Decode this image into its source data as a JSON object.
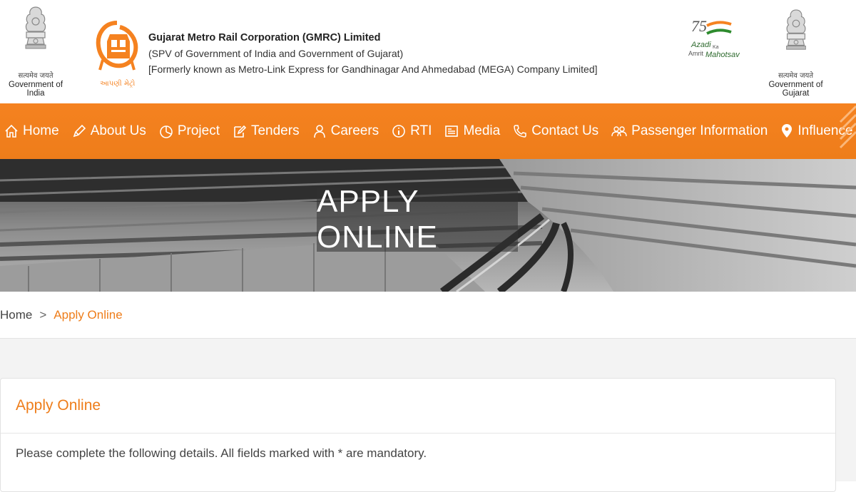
{
  "header": {
    "left_emblem": {
      "caption_hindi": "सत्यमेव जयते",
      "caption": "Government of India"
    },
    "company_name": "Gujarat Metro Rail Corporation (GMRC) Limited",
    "company_line1": "(SPV of Government of India and Government of Gujarat)",
    "company_line2": "[Formerly known as Metro-Link Express for Gandhinagar And Ahmedabad (MEGA) Company Limited]",
    "logo_tagline": "આપણી મેટ્રો",
    "azadi": {
      "number": "75",
      "word1": "Azadi",
      "word2": "Ka",
      "word3": "Amrit",
      "word4": "Mahotsav"
    },
    "right_emblem": {
      "caption_hindi": "सत्यमेव जयते",
      "caption": "Government of Gujarat"
    }
  },
  "nav": {
    "items": [
      {
        "label": "Home",
        "icon": "home-icon"
      },
      {
        "label": "About Us",
        "icon": "pencil-icon"
      },
      {
        "label": "Project",
        "icon": "pie-chart-icon"
      },
      {
        "label": "Tenders",
        "icon": "edit-icon"
      },
      {
        "label": "Careers",
        "icon": "user-icon"
      },
      {
        "label": "RTI",
        "icon": "info-icon"
      },
      {
        "label": "Media",
        "icon": "newspaper-icon"
      },
      {
        "label": "Contact Us",
        "icon": "phone-icon"
      },
      {
        "label": "Passenger Information",
        "icon": "users-icon"
      },
      {
        "label": "Influence Zone",
        "icon": "map-pin-icon"
      }
    ],
    "color": "#f58220"
  },
  "banner": {
    "title": "APPLY ONLINE"
  },
  "breadcrumb": {
    "home": "Home",
    "separator": ">",
    "current": "Apply Online"
  },
  "card": {
    "title": "Apply Online",
    "text": "Please complete the following details. All fields marked with * are mandatory."
  }
}
